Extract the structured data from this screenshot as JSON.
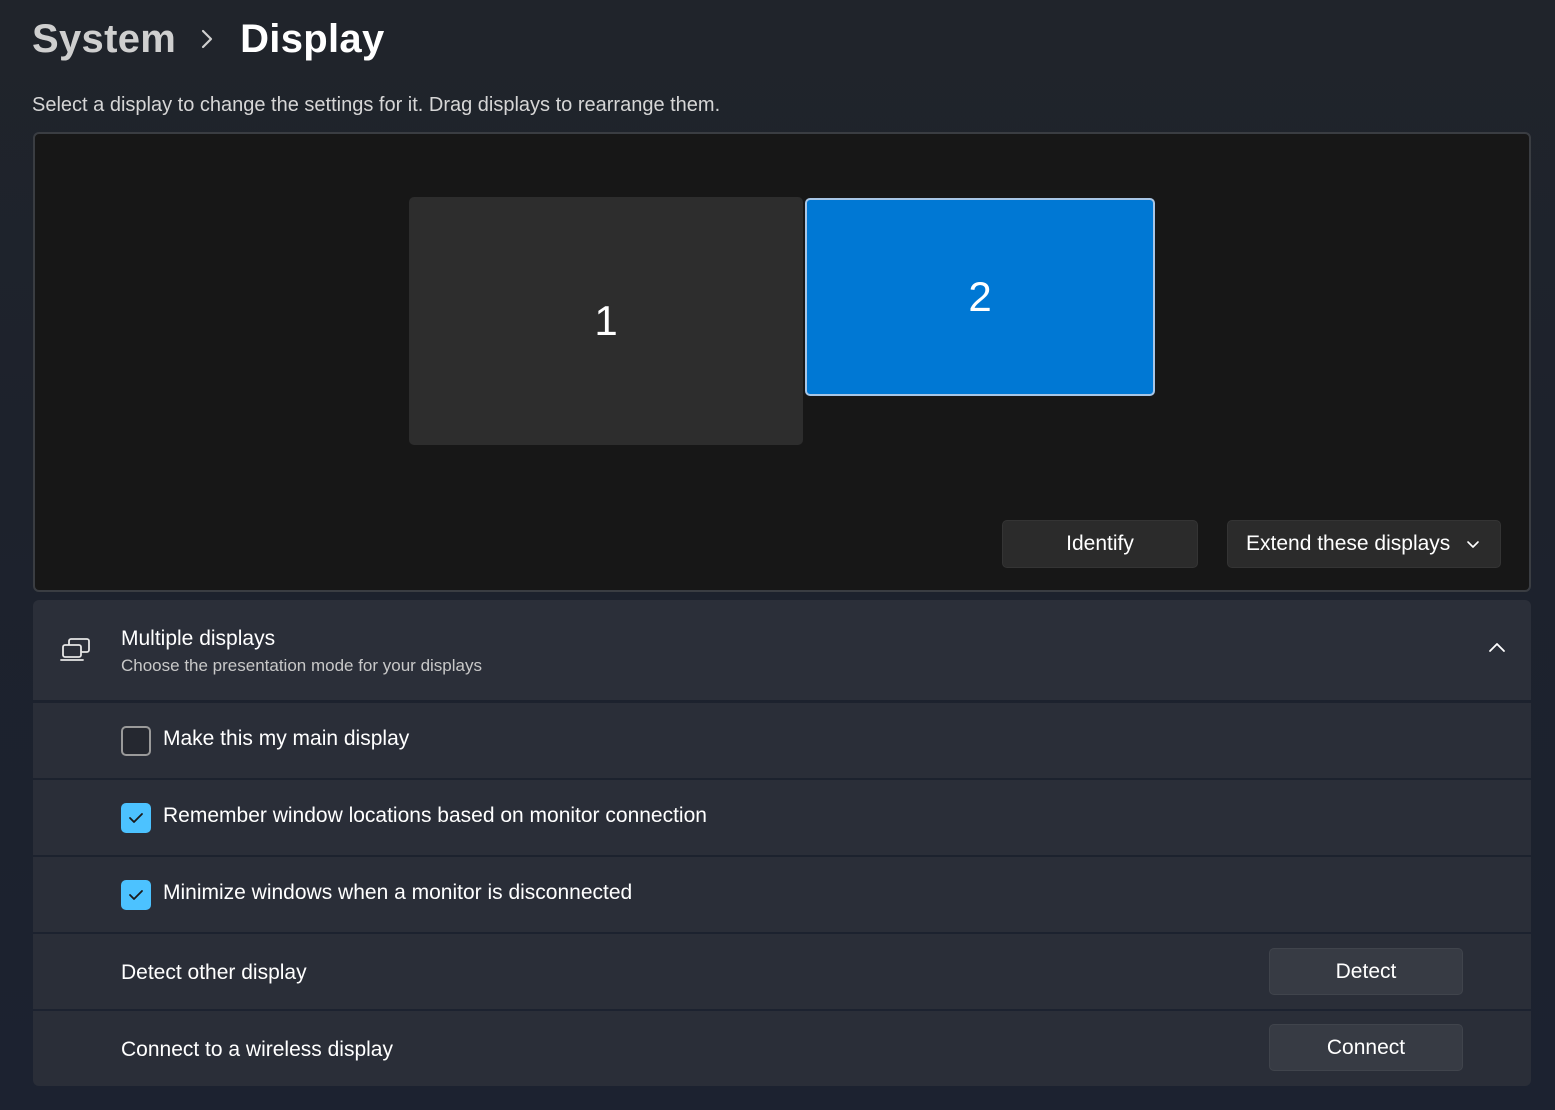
{
  "breadcrumb": {
    "parent": "System",
    "current": "Display"
  },
  "instruction": "Select a display to change the settings for it. Drag displays to rearrange them.",
  "monitors": [
    {
      "label": "1",
      "selected": false
    },
    {
      "label": "2",
      "selected": true
    }
  ],
  "arrange_actions": {
    "identify_label": "Identify",
    "mode_label": "Extend these displays"
  },
  "multiple_displays": {
    "title": "Multiple displays",
    "subtitle": "Choose the presentation mode for your displays",
    "options": [
      {
        "label": "Make this my main display",
        "checked": false
      },
      {
        "label": "Remember window locations based on monitor connection",
        "checked": true
      },
      {
        "label": "Minimize windows when a monitor is disconnected",
        "checked": true
      }
    ],
    "detect": {
      "label": "Detect other display",
      "button": "Detect"
    },
    "connect": {
      "label": "Connect to a wireless display",
      "button": "Connect"
    }
  },
  "colors": {
    "accent": "#0078d4",
    "checkbox_checked": "#4cc2ff"
  }
}
